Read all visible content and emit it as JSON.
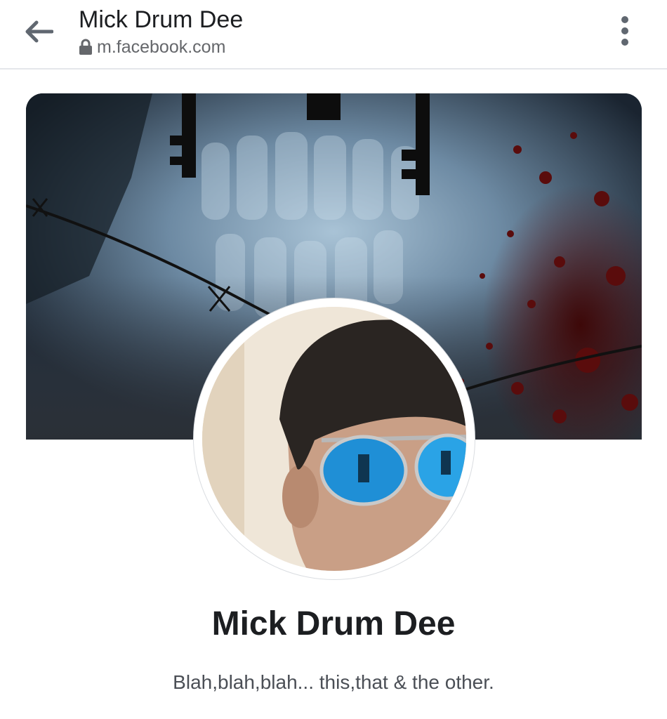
{
  "browser": {
    "title": "Mick Drum Dee",
    "url": "m.facebook.com",
    "icons": {
      "back": "arrow-left-icon",
      "lock": "lock-icon",
      "menu": "vertical-dots-icon"
    }
  },
  "profile": {
    "cover_photo": "dark collage with hanging keys, teeth x-ray, barbed wire and blood splatter",
    "profile_picture": "man with dark hair wearing blue mirrored aviator sunglasses",
    "name": "Mick Drum Dee",
    "bio": "Blah,blah,blah... this,that & the other."
  },
  "colors": {
    "text_primary": "#1c1e21",
    "text_secondary": "#65676b",
    "divider": "#e4e6eb",
    "background": "#ffffff"
  }
}
